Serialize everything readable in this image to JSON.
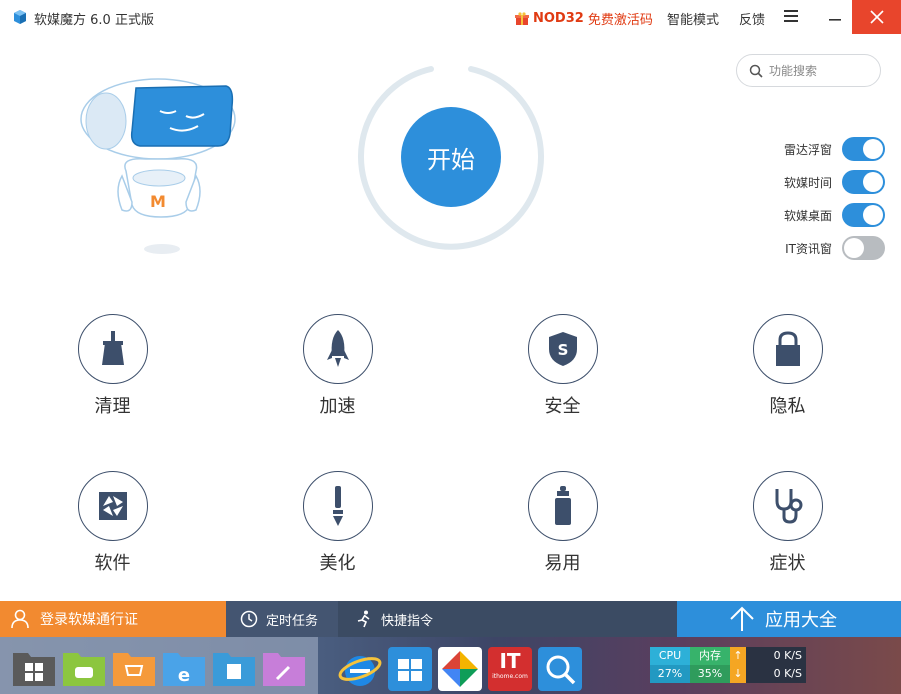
{
  "titlebar": {
    "app_title": "软媒魔方 6.0 正式版",
    "promo_brand": "NOD32",
    "promo_text": "免费激活码",
    "smart_mode": "智能模式",
    "feedback": "反馈"
  },
  "main": {
    "start_label": "开始",
    "search_placeholder": "功能搜索",
    "toggles": [
      {
        "label": "雷达浮窗",
        "state": "on"
      },
      {
        "label": "软媒时间",
        "state": "on"
      },
      {
        "label": "软媒桌面",
        "state": "on"
      },
      {
        "label": "IT资讯窗",
        "state": "off"
      }
    ]
  },
  "tools": [
    {
      "label": "清理",
      "icon": "broom-icon"
    },
    {
      "label": "加速",
      "icon": "rocket-icon"
    },
    {
      "label": "安全",
      "icon": "shield-icon"
    },
    {
      "label": "隐私",
      "icon": "lock-icon"
    },
    {
      "label": "软件",
      "icon": "aperture-icon"
    },
    {
      "label": "美化",
      "icon": "brush-icon"
    },
    {
      "label": "易用",
      "icon": "bottle-icon"
    },
    {
      "label": "症状",
      "icon": "stethoscope-icon"
    }
  ],
  "bottombar": {
    "login": "登录软媒通行证",
    "timer": "定时任务",
    "quick": "快捷指令",
    "apps": "应用大全"
  },
  "sysmon": {
    "cpu_label": "CPU",
    "cpu_value": "27%",
    "mem_label": "内存",
    "mem_value": "35%",
    "up_value": "0 K/S",
    "down_value": "0 K/S"
  },
  "taskbar": {
    "ithome_text": "IT",
    "ithome_sub": "ithome.com"
  },
  "colors": {
    "accent": "#2d8fdb",
    "login_orange": "#f28a30",
    "close_red": "#e8452c",
    "dark_bar": "#3b4b63"
  }
}
